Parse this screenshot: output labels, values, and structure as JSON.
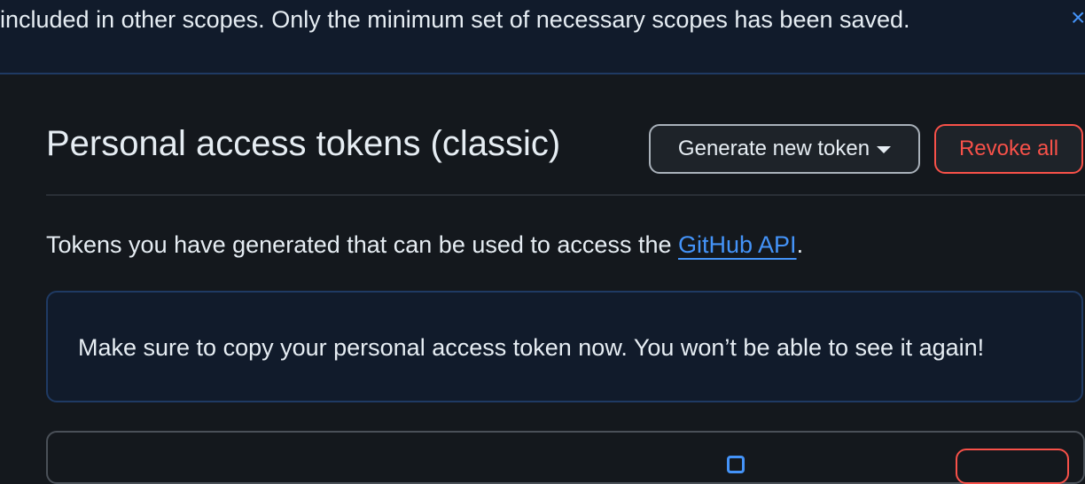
{
  "flash": {
    "message": "included in other scopes. Only the minimum set of necessary scopes has been saved.",
    "close_icon": "×"
  },
  "header": {
    "title": "Personal access tokens (classic)",
    "generate_label": "Generate new token",
    "revoke_label": "Revoke all"
  },
  "description": {
    "prefix": "Tokens you have generated that can be used to access the ",
    "link_label": "GitHub API",
    "suffix": "."
  },
  "notice": {
    "message": "Make sure to copy your personal access token now. You won’t be able to see it again!"
  },
  "colors": {
    "background": "#14181d",
    "accent_blue": "#4493f8",
    "danger_red": "#f85149"
  }
}
